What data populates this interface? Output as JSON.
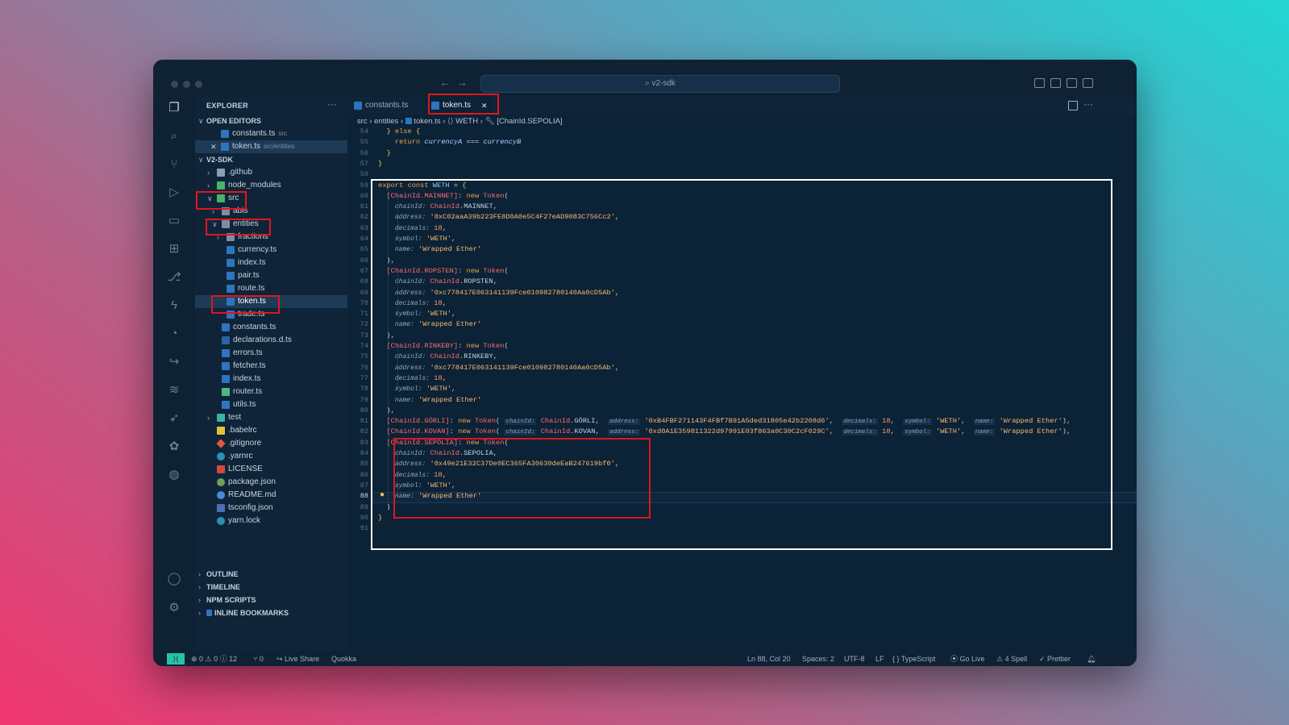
{
  "window": {
    "search_label": "v2-sdk"
  },
  "sidebar": {
    "header": "EXPLORER",
    "more": "···",
    "open_editors": {
      "title": "OPEN EDITORS",
      "items": [
        {
          "name": "constants.ts",
          "hint": "src"
        },
        {
          "name": "token.ts",
          "hint": "src/entities",
          "close": "✕"
        }
      ]
    },
    "project": {
      "title": "V2-SDK",
      "items": [
        {
          "name": ".github"
        },
        {
          "name": "node_modules"
        },
        {
          "name": "src"
        },
        {
          "name": "abis"
        },
        {
          "name": "entities"
        },
        {
          "name": "fractions"
        },
        {
          "name": "currency.ts"
        },
        {
          "name": "index.ts"
        },
        {
          "name": "pair.ts"
        },
        {
          "name": "route.ts"
        },
        {
          "name": "token.ts"
        },
        {
          "name": "trade.ts"
        },
        {
          "name": "constants.ts"
        },
        {
          "name": "declarations.d.ts"
        },
        {
          "name": "errors.ts"
        },
        {
          "name": "fetcher.ts"
        },
        {
          "name": "index.ts"
        },
        {
          "name": "router.ts"
        },
        {
          "name": "utils.ts"
        },
        {
          "name": "test"
        },
        {
          "name": ".babelrc"
        },
        {
          "name": ".gitignore"
        },
        {
          "name": ".yarnrc"
        },
        {
          "name": "LICENSE"
        },
        {
          "name": "package.json"
        },
        {
          "name": "README.md"
        },
        {
          "name": "tsconfig.json"
        },
        {
          "name": "yarn.lock"
        }
      ]
    },
    "sections": [
      "OUTLINE",
      "TIMELINE",
      "NPM SCRIPTS",
      "INLINE BOOKMARKS"
    ]
  },
  "tabs": [
    {
      "label": "constants.ts"
    },
    {
      "label": "token.ts",
      "close": "✕"
    }
  ],
  "breadcrumbs": [
    "src",
    "entities",
    "token.ts",
    "WETH",
    "[ChainId.SEPOLIA]"
  ],
  "editor": {
    "line_numbers": [
      "54",
      "55",
      "56",
      "57",
      "58",
      "59",
      "60",
      "61",
      "62",
      "63",
      "64",
      "65",
      "66",
      "67",
      "68",
      "69",
      "70",
      "71",
      "72",
      "73",
      "74",
      "75",
      "76",
      "77",
      "78",
      "79",
      "80",
      "81",
      "82",
      "83",
      "84",
      "85",
      "86",
      "87",
      "88",
      "89",
      "90",
      "91"
    ],
    "current_line": "88"
  },
  "status": {
    "problems": "⊗ 0 ⚠ 0 ⓘ 12",
    "ports": "⑂ 0",
    "live_share": "Live Share",
    "quokka": "Quokka",
    "position": "Ln 88, Col 20",
    "spaces": "Spaces: 2",
    "encoding": "UTF-8",
    "eol": "LF",
    "language": "{ } TypeScript",
    "go_live": "Go Live",
    "spell": "⚠ 4 Spell",
    "prettier": "✓ Prettier"
  }
}
